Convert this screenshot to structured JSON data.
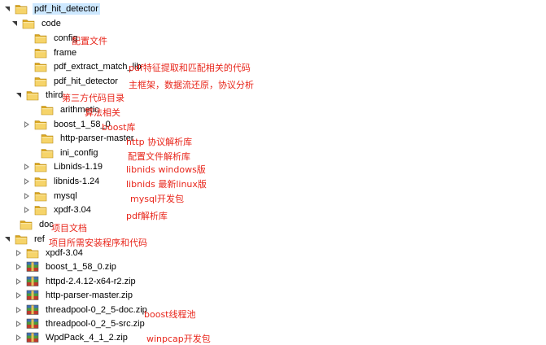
{
  "tree": {
    "root": {
      "label": "pdf_hit_detector"
    },
    "code": {
      "label": "code"
    },
    "config": {
      "label": "config",
      "note": "配置文件"
    },
    "frame": {
      "label": "frame"
    },
    "pdf_extract_match_lib": {
      "label": "pdf_extract_match_lib",
      "note": "pdf特征提取和匹配相关的代码"
    },
    "pdf_hit_detector_sub": {
      "label": "pdf_hit_detector",
      "note": "主框架，数据流还原，协议分析"
    },
    "third": {
      "label": "third",
      "note": "第三方代码目录"
    },
    "arithmetic": {
      "label": "arithmetic",
      "note": "算法相关"
    },
    "boost_1_58_0": {
      "label": "boost_1_58_0",
      "note": "boost库"
    },
    "http_parser_master": {
      "label": "http-parser-master",
      "note": "http 协议解析库"
    },
    "ini_config": {
      "label": "ini_config",
      "note": "配置文件解析库"
    },
    "libnids_119": {
      "label": "Libnids-1.19",
      "note": "libnids windows版"
    },
    "libnids_124": {
      "label": "libnids-1.24",
      "note": "libnids 最新linux版"
    },
    "mysql": {
      "label": "mysql",
      "note": "mysql开发包"
    },
    "xpdf_304_third": {
      "label": "xpdf-3.04",
      "note": "pdf解析库"
    },
    "doc": {
      "label": "doc",
      "note": "项目文档"
    },
    "ref": {
      "label": "ref",
      "note": "项目所需安装程序和代码"
    },
    "xpdf_304_ref": {
      "label": "xpdf-3.04"
    },
    "boost_zip": {
      "label": "boost_1_58_0.zip"
    },
    "httpd_zip": {
      "label": "httpd-2.4.12-x64-r2.zip"
    },
    "http_parser_zip": {
      "label": "http-parser-master.zip"
    },
    "threadpool_doc_zip": {
      "label": "threadpool-0_2_5-doc.zip",
      "note": "boost线程池"
    },
    "threadpool_src_zip": {
      "label": "threadpool-0_2_5-src.zip"
    },
    "wpdpack_zip": {
      "label": "WpdPack_4_1_2.zip",
      "note": "winpcap开发包"
    }
  },
  "colors": {
    "folder": "#e8b730",
    "folder_light": "#f6d46a",
    "note": "#e8261b",
    "selection": "#cde8ff"
  },
  "icons": {
    "folder": "folder-icon",
    "archive": "archive-icon",
    "expanded": "expanded-arrow-icon",
    "collapsed": "collapsed-arrow-icon"
  }
}
